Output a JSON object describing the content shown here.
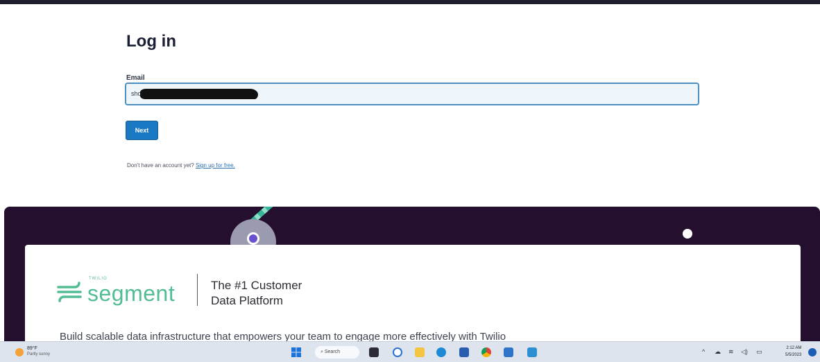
{
  "login": {
    "title": "Log in",
    "email_label": "Email",
    "email_value": "shob",
    "next_label": "Next",
    "no_account_text": "Don't have an account yet?",
    "signup_link": "Sign up for free."
  },
  "promo": {
    "brand_small": "TWILIO",
    "brand_name": "segment",
    "tagline_line1": "The #1 Customer",
    "tagline_line2": "Data Platform",
    "body_text": "Build scalable data infrastructure that empowers your team to engage more effectively with Twilio",
    "brand_color": "#52bd94",
    "panel_color": "#240f2e"
  },
  "taskbar": {
    "weather_temp": "89°F",
    "weather_desc": "Partly sunny",
    "search_label": "Search",
    "clock_time": "2:12 AM",
    "clock_date": "5/5/2023",
    "icons": [
      "windows-start-icon",
      "search-icon",
      "file-explorer-icon",
      "chat-icon",
      "folder-icon",
      "edge-icon",
      "store-icon",
      "chrome-icon",
      "mail-icon",
      "shop-icon"
    ]
  }
}
